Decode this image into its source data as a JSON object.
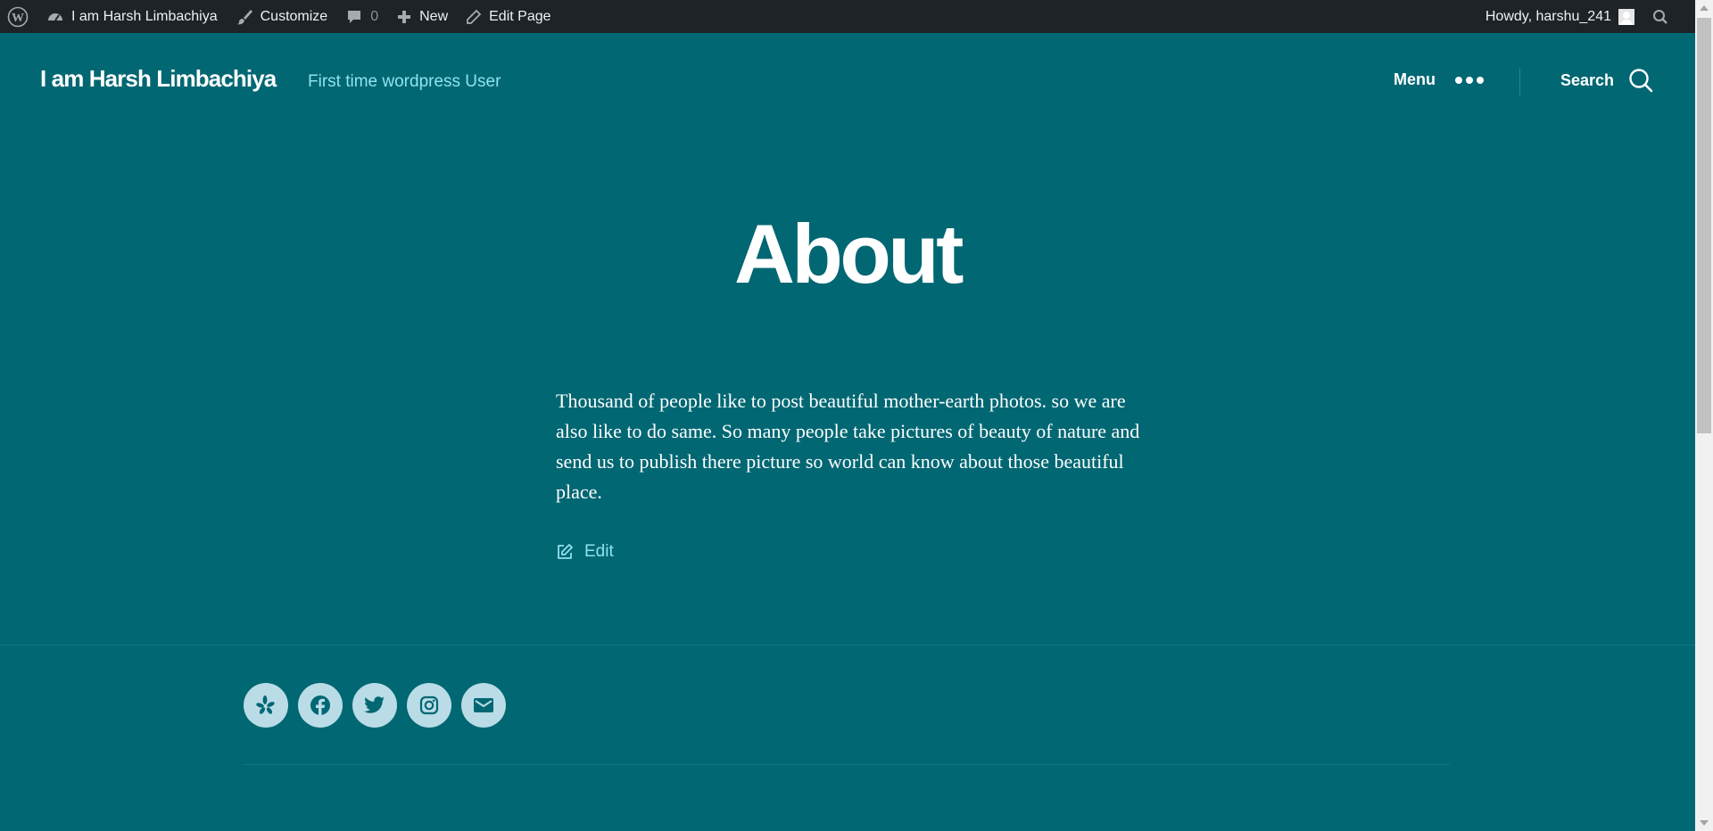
{
  "adminbar": {
    "wp_logo_icon": "wordpress-logo-icon",
    "site_name": "I am Harsh Limbachiya",
    "customize": "Customize",
    "comments_count": "0",
    "new": "New",
    "edit_page": "Edit Page",
    "howdy": "Howdy, harshu_241"
  },
  "header": {
    "site_title": "I am Harsh Limbachiya",
    "tagline": "First time wordpress User",
    "menu_label": "Menu",
    "search_label": "Search"
  },
  "main": {
    "title": "About",
    "content": "Thousand of people like to post beautiful mother-earth photos. so we are also like to do same. So many people take pictures of beauty of nature and send us to publish there picture so world can know about those beautiful place.",
    "edit_label": "Edit"
  },
  "footer": {
    "social": [
      "yelp-icon",
      "facebook-icon",
      "twitter-icon",
      "instagram-icon",
      "mail-icon"
    ]
  },
  "colors": {
    "background": "#006773",
    "adminbar": "#1d2327",
    "accent_text": "#8fe3ef",
    "social_bg": "#b9dce6"
  }
}
